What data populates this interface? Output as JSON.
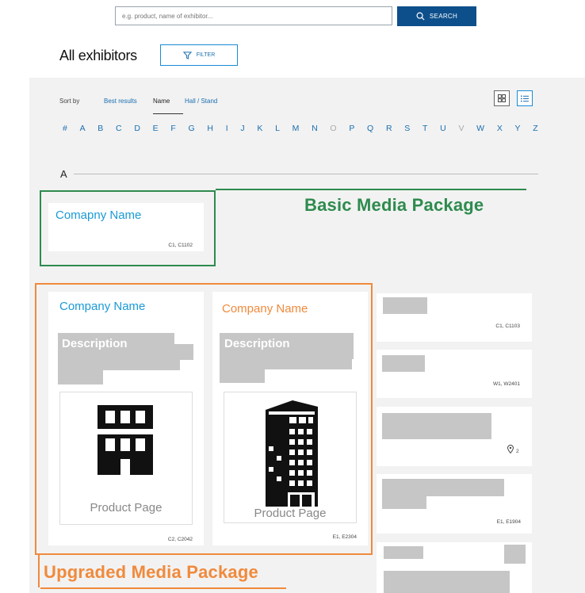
{
  "search": {
    "placeholder": "e.g. product, name of exhibitor...",
    "button_label": "SEARCH"
  },
  "header": {
    "title": "All exhibitors",
    "filter_label": "FILTER"
  },
  "sort": {
    "label": "Sort by",
    "options": [
      "Best results",
      "Name",
      "Hall / Stand"
    ],
    "selected": "Name"
  },
  "alphabet": [
    "#",
    "A",
    "B",
    "C",
    "D",
    "E",
    "F",
    "G",
    "H",
    "I",
    "J",
    "K",
    "L",
    "M",
    "N",
    "O",
    "P",
    "Q",
    "R",
    "S",
    "T",
    "U",
    "V",
    "W",
    "X",
    "Y",
    "Z"
  ],
  "alphabet_disabled": [
    "O",
    "V"
  ],
  "section_letter": "A",
  "basic_card": {
    "name": "Comapny Name",
    "stand": "C1, C1102"
  },
  "upgraded_cards": [
    {
      "name": "Company Name",
      "description": "Description",
      "product_label": "Product Page",
      "stand": "C2, C2042"
    },
    {
      "name": "Company Name",
      "description": "Description",
      "product_label": "Product Page",
      "stand": "E1, E2304"
    }
  ],
  "right_cards": [
    {
      "stand": "C1, C1103"
    },
    {
      "stand": "W1, W2401"
    },
    {
      "badge": "2"
    },
    {
      "stand": "E1, E1904"
    },
    {
      "stand": ""
    }
  ],
  "annotations": {
    "basic": "Basic Media Package",
    "upgraded": "Upgraded Media Package"
  },
  "colors": {
    "primary": "#0d4f8b",
    "link": "#1a6fb0",
    "basic_annotation": "#2e8b4e",
    "upgraded_annotation": "#f08a3c",
    "panel_bg": "#f2f2f2",
    "placeholder_block": "#c6c6c6"
  }
}
